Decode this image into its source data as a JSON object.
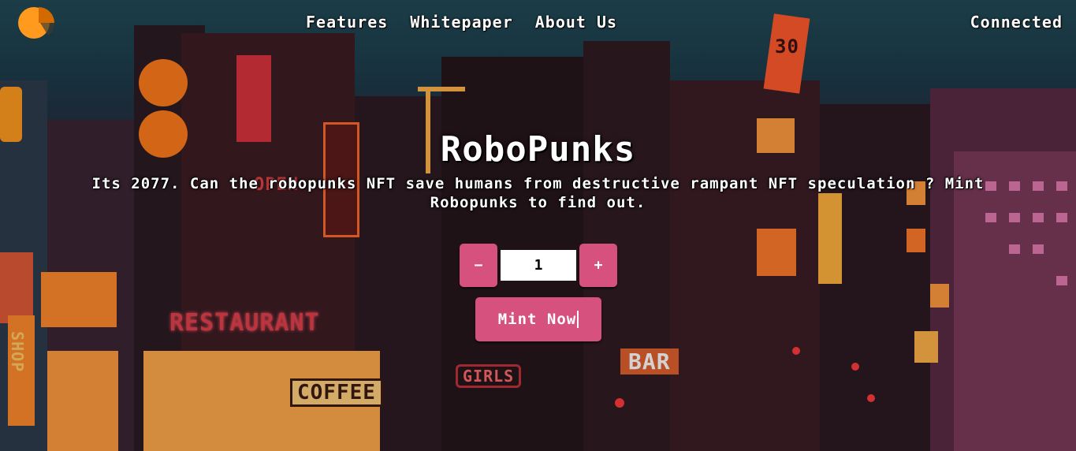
{
  "nav": {
    "logo_icon": "orange-pie-logo-icon",
    "links": [
      "Features",
      "Whitepaper",
      "About Us"
    ],
    "status": "Connected"
  },
  "hero": {
    "title": "RoboPunks",
    "subtitle": "Its 2077. Can the robopunks NFT save humans from destructive rampant NFT speculation ? Mint Robopunks to find out.",
    "decrement_label": "−",
    "quantity_value": "1",
    "increment_label": "+",
    "mint_label": "Mint Now"
  },
  "backdrop": {
    "signs": [
      "RESTAURANT",
      "COFFEE",
      "SHOP",
      "GIRLS",
      "BAR",
      "30",
      "OPEN"
    ]
  },
  "colors": {
    "accent": "#d6517d",
    "logo_orange": "#ff9a1f",
    "text": "#ffffff"
  }
}
